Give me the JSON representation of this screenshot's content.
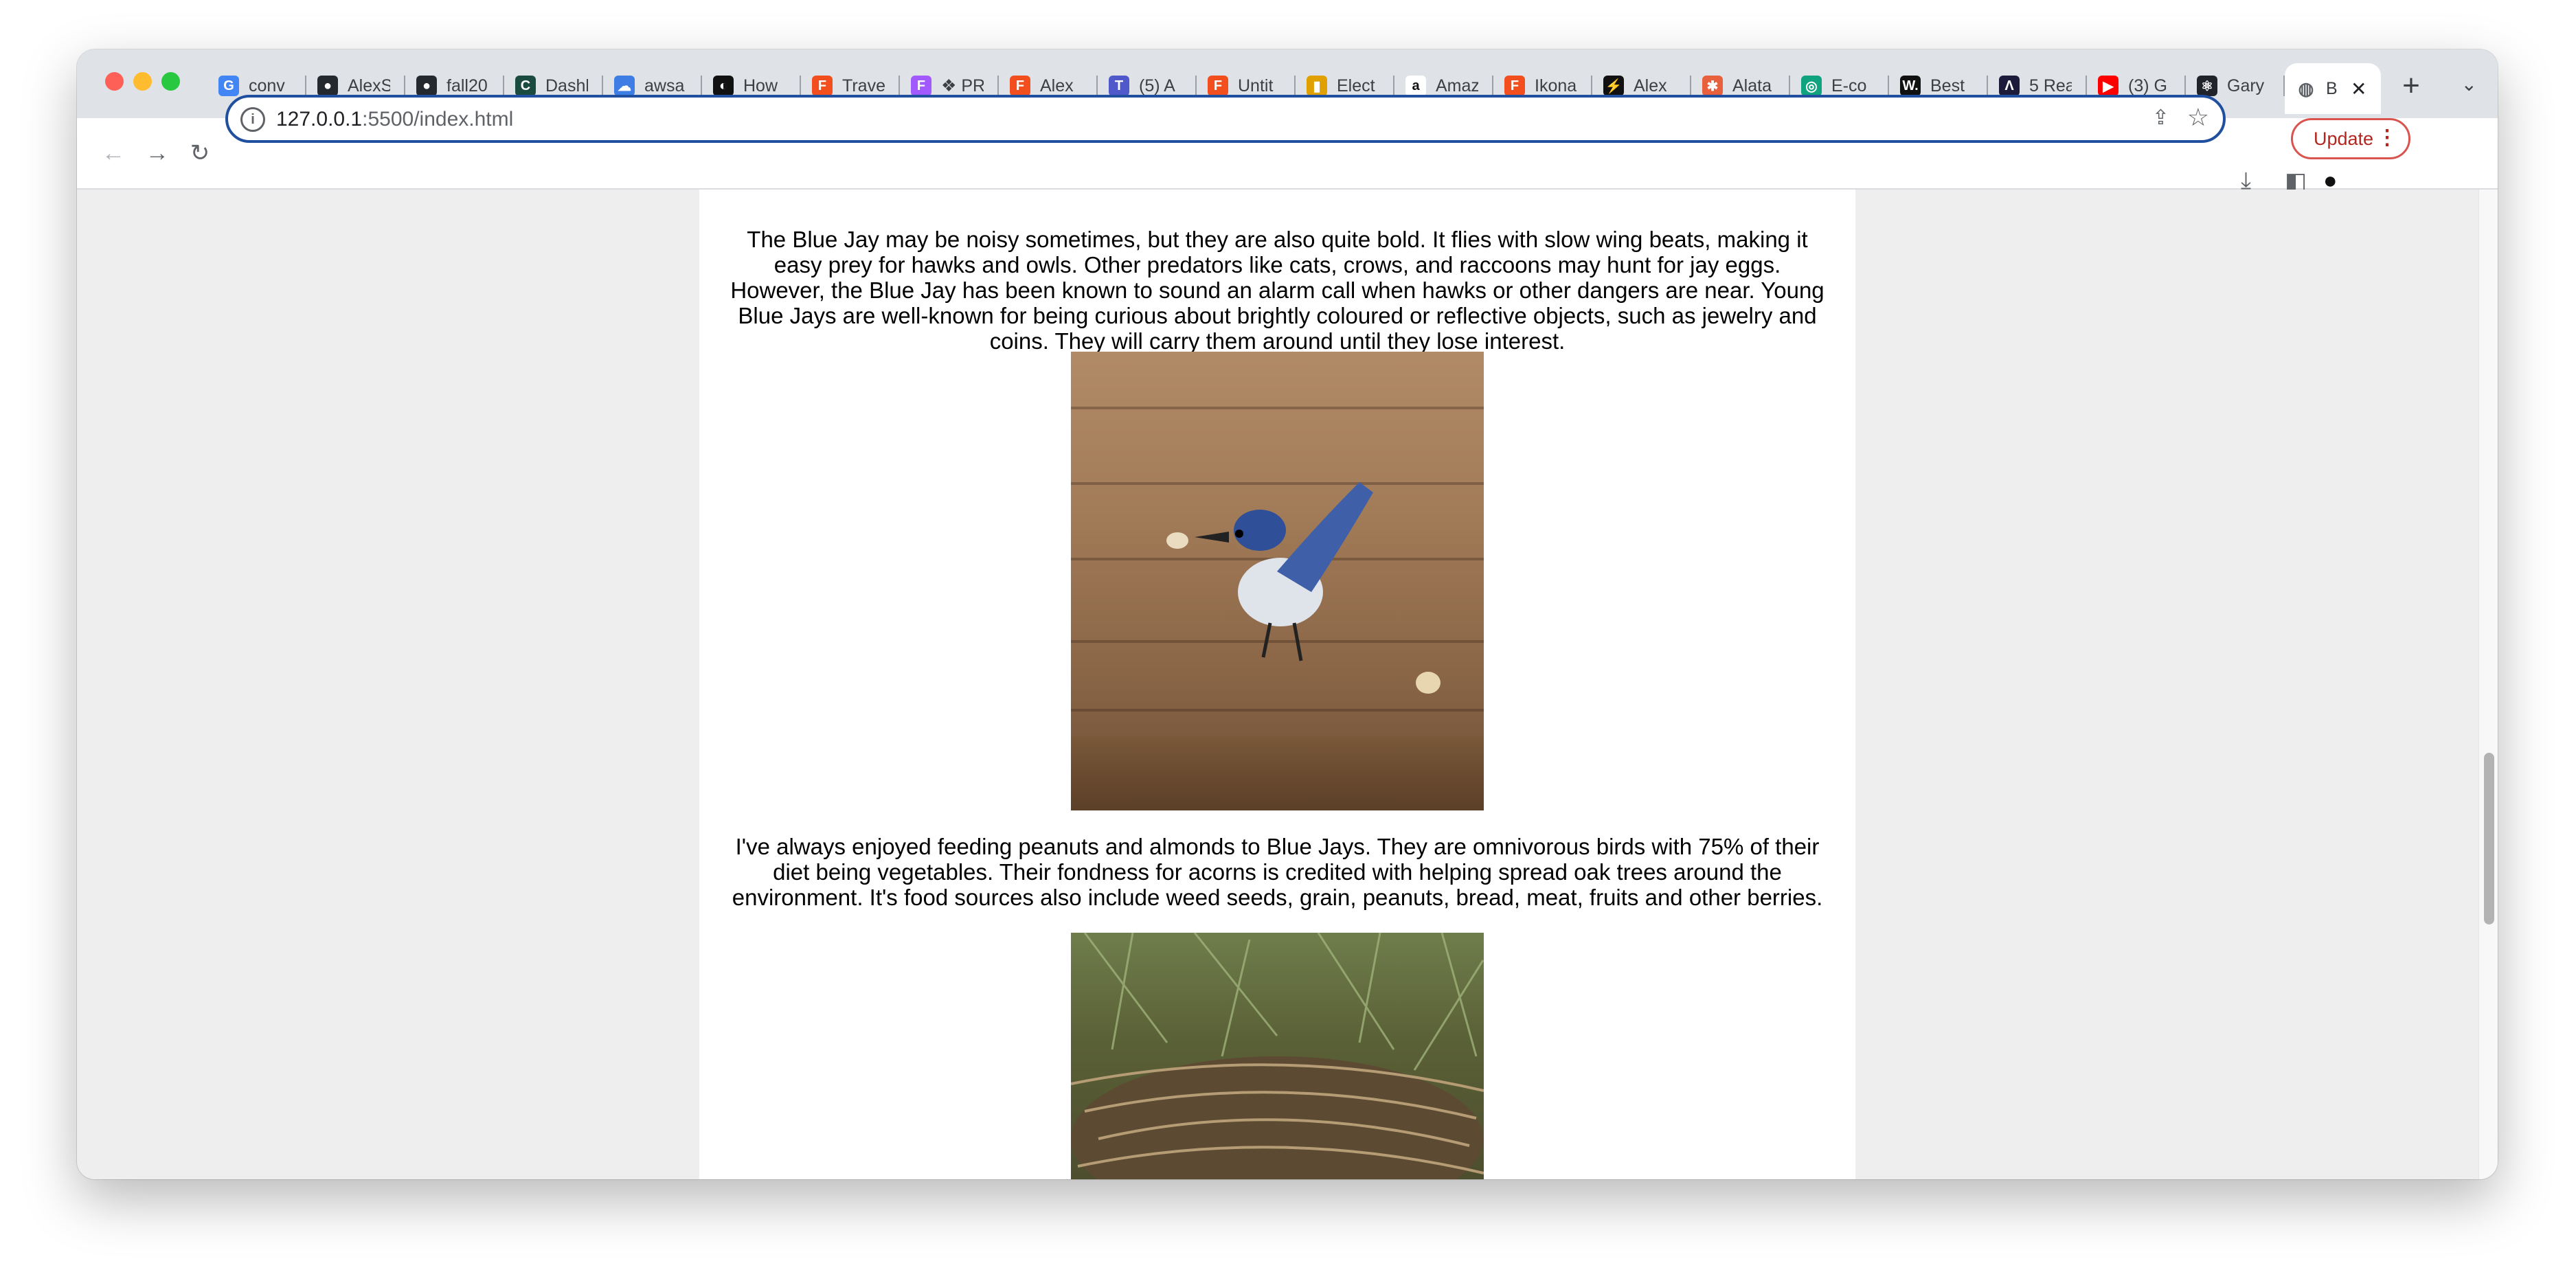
{
  "browser": {
    "tabs": [
      {
        "title": "conv",
        "icon": "google-icon",
        "color": "#4285f4",
        "glyph": "G"
      },
      {
        "title": "AlexS",
        "icon": "github-icon",
        "color": "#24292f",
        "glyph": "●"
      },
      {
        "title": "fall20",
        "icon": "github-icon",
        "color": "#24292f",
        "glyph": "●"
      },
      {
        "title": "Dashl",
        "icon": "c-app-icon",
        "color": "#1b4a3f",
        "glyph": "C"
      },
      {
        "title": "awsa",
        "icon": "cloud-icon",
        "color": "#3d7de4",
        "glyph": "☁"
      },
      {
        "title": "How",
        "icon": "circle-logo-icon",
        "color": "#111111",
        "glyph": "◐"
      },
      {
        "title": "Trave",
        "icon": "figma-icon",
        "color": "#f24e1e",
        "glyph": "F"
      },
      {
        "title": "❖ PR",
        "icon": "figma-icon",
        "color": "#a259ff",
        "glyph": "F"
      },
      {
        "title": "Alex",
        "icon": "figma-icon",
        "color": "#f24e1e",
        "glyph": "F"
      },
      {
        "title": "(5) A",
        "icon": "teams-icon",
        "color": "#5059c9",
        "glyph": "T"
      },
      {
        "title": "Untit",
        "icon": "figma-icon",
        "color": "#f24e1e",
        "glyph": "F"
      },
      {
        "title": "Elect",
        "icon": "bag-icon",
        "color": "#e0a100",
        "glyph": "▮"
      },
      {
        "title": "Amaz",
        "icon": "amazon-icon",
        "color": "#ffffff",
        "glyph": "a"
      },
      {
        "title": "Ikona",
        "icon": "figma-icon",
        "color": "#f24e1e",
        "glyph": "F"
      },
      {
        "title": "Alex",
        "icon": "framer-icon",
        "color": "#111111",
        "glyph": "⚡"
      },
      {
        "title": "Alata",
        "icon": "colorful-logo-icon",
        "color": "#e8613c",
        "glyph": "✱"
      },
      {
        "title": "E-co",
        "icon": "openai-icon",
        "color": "#10a37f",
        "glyph": "◎"
      },
      {
        "title": "Best",
        "icon": "w-logo-icon",
        "color": "#111111",
        "glyph": "W."
      },
      {
        "title": "5 Rea",
        "icon": "a-logo-icon",
        "color": "#1c1c3a",
        "glyph": "Λ"
      },
      {
        "title": "(3) G",
        "icon": "youtube-icon",
        "color": "#ff0000",
        "glyph": "▶"
      },
      {
        "title": "Gary",
        "icon": "react-icon",
        "color": "#20232a",
        "glyph": "⚛"
      }
    ],
    "active_tab": {
      "title": "B",
      "icon": "globe-icon",
      "close": "✕"
    },
    "new_tab": "+",
    "tab_menu": "⌄",
    "url_host": "127.0.0.1",
    "url_rest": ":5500/index.html",
    "update_label": "Update",
    "update_color": "#b3261e"
  },
  "page": {
    "paragraph1": "The Blue Jay may be noisy sometimes, but they are also quite bold. It flies with slow wing beats, making it easy prey for hawks and owls. Other predators like cats, crows, and raccoons may hunt for jay eggs. However, the Blue Jay has been known to sound an alarm call when hawks or other dangers are near. Young Blue Jays are well-known for being curious about brightly coloured or reflective objects, such as jewelry and coins. They will carry them around until they lose interest.",
    "paragraph2": "I've always enjoyed feeding peanuts and almonds to Blue Jays. They are omnivorous birds with 75% of their diet being vegetables. Their fondness for acorns is credited with helping spread oak trees around the environment. It's food sources also include weed seeds, grain, peanuts, bread, meat, fruits and other berries."
  }
}
